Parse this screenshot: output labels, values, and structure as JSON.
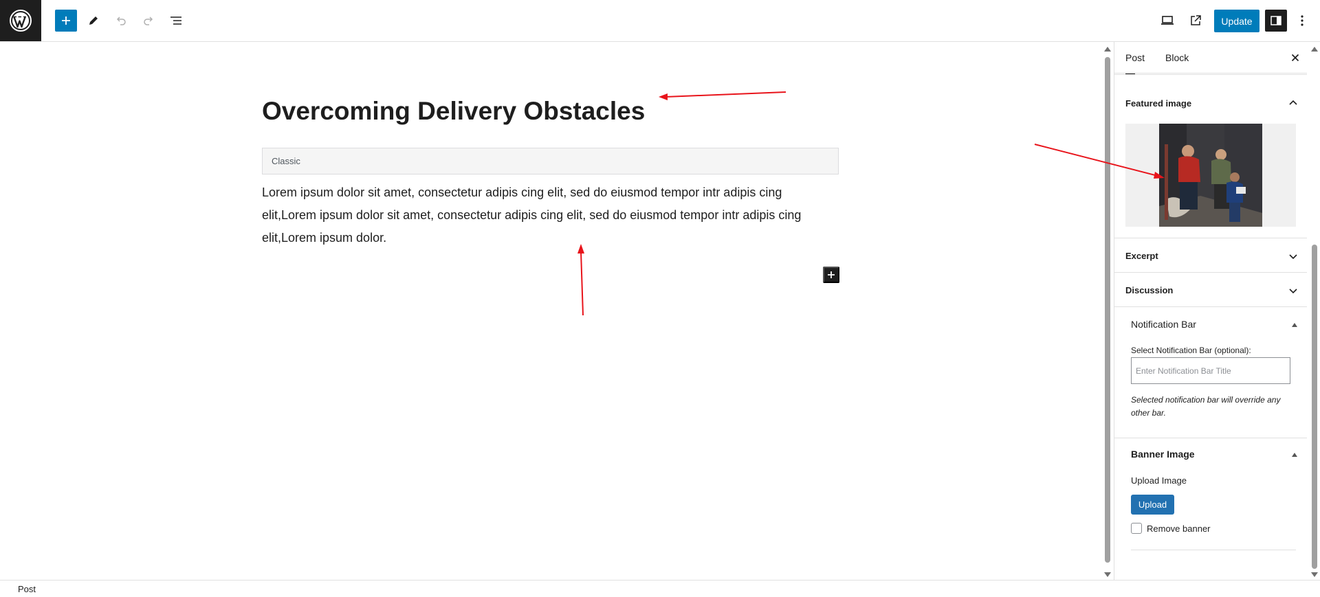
{
  "toolbar": {
    "update_label": "Update"
  },
  "editor": {
    "post_title": "Overcoming Delivery Obstacles",
    "classic_block_label": "Classic",
    "body_text": "Lorem ipsum dolor sit amet, consectetur adipis cing elit, sed do eiusmod tempor intr adipis cing elit,Lorem ipsum dolor sit amet, consectetur adipis cing elit, sed do eiusmod tempor intr adipis cing elit,Lorem ipsum dolor."
  },
  "sidebar": {
    "tabs": [
      {
        "label": "Post",
        "active": true
      },
      {
        "label": "Block",
        "active": false
      }
    ],
    "panels": {
      "featured_image": "Featured image",
      "excerpt": "Excerpt",
      "discussion": "Discussion",
      "notification_bar": "Notification Bar",
      "banner_image": "Banner Image"
    },
    "notification": {
      "label": "Select Notification Bar (optional):",
      "placeholder": "Enter Notification Bar Title",
      "value": "",
      "note": "Selected notification bar will override any other bar."
    },
    "banner": {
      "upload_label": "Upload Image",
      "upload_button": "Upload",
      "remove_label": "Remove banner",
      "remove_checked": false
    }
  },
  "footer": {
    "breadcrumb": "Post"
  },
  "colors": {
    "accent": "#007cba",
    "upload_button": "#2271b1",
    "dark": "#1e1e1e",
    "annotation": "#e8141b"
  },
  "icons": [
    "wordpress-logo-icon",
    "plus-icon",
    "pencil-icon",
    "undo-icon",
    "redo-icon",
    "list-view-icon",
    "desktop-preview-icon",
    "external-link-icon",
    "sidebar-toggle-icon",
    "more-vertical-icon",
    "close-icon",
    "chevron-up-icon",
    "chevron-down-icon",
    "triangle-up-icon"
  ]
}
